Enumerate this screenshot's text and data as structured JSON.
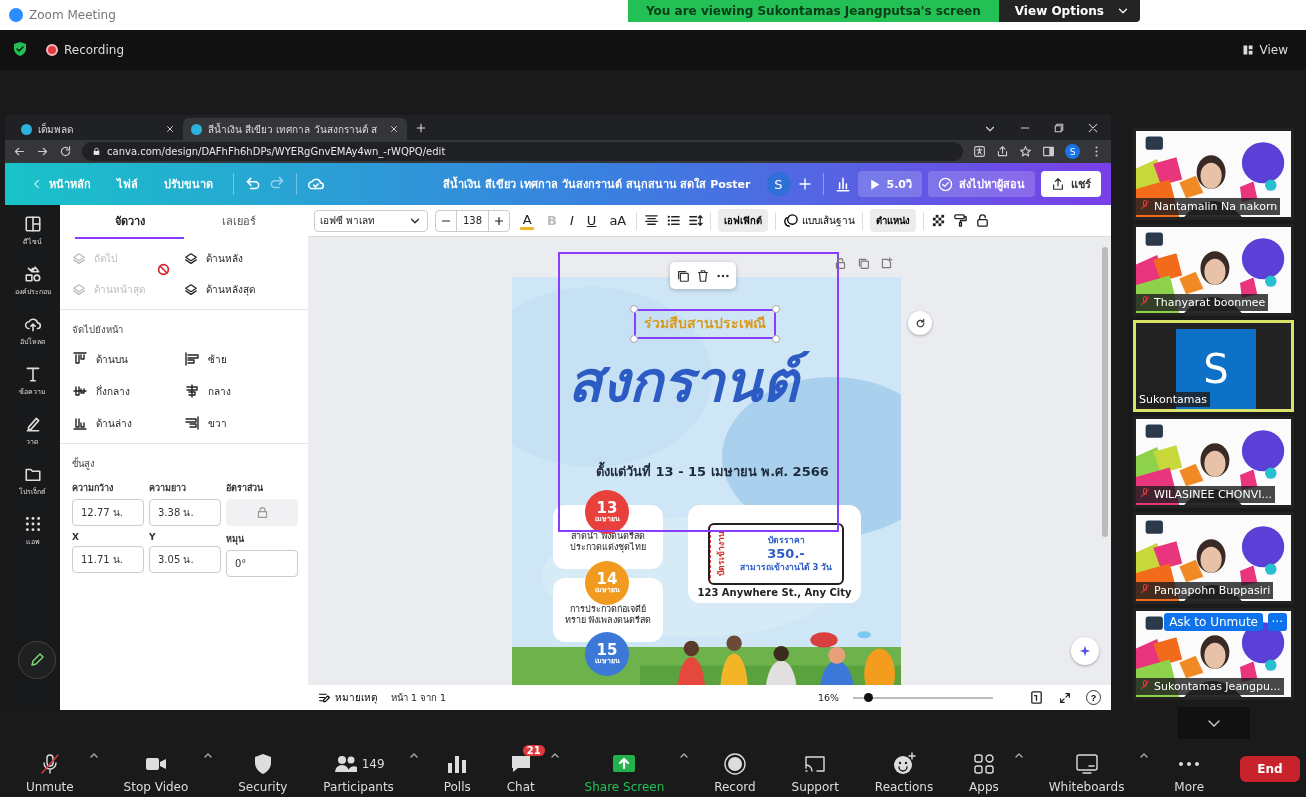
{
  "window": {
    "title": "Zoom Meeting"
  },
  "share_banner": {
    "text": "You are viewing Sukontamas Jeangputsa's screen",
    "button": "View Options"
  },
  "top_bar": {
    "recording": "Recording",
    "view": "View"
  },
  "browser": {
    "tabs": [
      {
        "label": "เต็มพลด",
        "selected": false
      },
      {
        "label": "สีน้ำเงิน สีเขียว เทศกาล วันสงกรานต์ ส",
        "selected": true
      }
    ],
    "url": "canva.com/design/DAFhFh6hDPs/WYERgGnvEMAy4wn_-rWQPQ/edit",
    "profile": "S"
  },
  "canva_header": {
    "nav": [
      "หน้าหลัก",
      "ไฟล์",
      "ปรับขนาด"
    ],
    "title": "สีน้ำเงิน สีเขียว เทศกาล วันสงกรานต์ สนุกสนาน สดใส Poster",
    "avatar": "S",
    "timer": "5.0วิ",
    "send": "ส่งไปหาผู้สอน",
    "share": "แชร์"
  },
  "rail": [
    {
      "kind": "design",
      "label": "ดีไซน์"
    },
    {
      "kind": "elements",
      "label": "องค์ประกอบ"
    },
    {
      "kind": "upload",
      "label": "อัปโหลด"
    },
    {
      "kind": "text",
      "label": "ข้อความ"
    },
    {
      "kind": "draw",
      "label": "วาด"
    },
    {
      "kind": "projects",
      "label": "โปรเจ็กต์"
    },
    {
      "kind": "apps",
      "label": "แอพ"
    }
  ],
  "panel": {
    "tabs": [
      {
        "label": "จัดวาง",
        "selected": true
      },
      {
        "label": "เลเยอร์",
        "selected": false
      }
    ],
    "order": [
      {
        "label": "ถัดไป",
        "disabled": true
      },
      {
        "label": "ด้านหลัง",
        "disabled": false
      },
      {
        "label": "ด้านหน้าสุด",
        "disabled": true
      },
      {
        "label": "ด้านหลังสุด",
        "disabled": false
      }
    ],
    "align_heading": "จัดไปยังหน้า",
    "align": [
      {
        "kind": "top",
        "label": "ด้านบน"
      },
      {
        "kind": "left",
        "label": "ซ้าย"
      },
      {
        "kind": "middle",
        "label": "กึ่งกลาง"
      },
      {
        "kind": "center",
        "label": "กลาง"
      },
      {
        "kind": "bottom",
        "label": "ด้านล่าง"
      },
      {
        "kind": "right",
        "label": "ขวา"
      }
    ],
    "advanced_heading": "ขั้นสูง",
    "fields": [
      {
        "label": "ความกว้าง",
        "value": "12.77 น."
      },
      {
        "label": "ความยาว",
        "value": "3.38 น."
      },
      {
        "label": "อัตราส่วน",
        "kind": "lock"
      },
      {
        "label": "X",
        "value": "11.71 น."
      },
      {
        "label": "Y",
        "value": "3.05 น."
      },
      {
        "label": "หมุน",
        "value": "0°"
      }
    ]
  },
  "toolbar": {
    "font": "เอฟซี พาเลท",
    "size": "138",
    "text_color": "A",
    "formats": [
      {
        "label": "B",
        "disabled": true
      },
      {
        "label": "I",
        "disabled": false
      },
      {
        "label": "U",
        "disabled": false
      },
      {
        "label": "aA",
        "disabled": false
      }
    ],
    "effects": "เอฟเฟิกต์",
    "animate": "แบบเส้นฐาน",
    "position": "ตำแหน่ง"
  },
  "poster": {
    "tagline": "ร่วมสืบสานประเพณี",
    "title": "สงกรานต์",
    "dates": "ตั้งแต่วันที่ 13 - 15 เมษายน พ.ศ. 2566",
    "events": [
      {
        "day": "13",
        "month": "เมษายน",
        "color": "#e8403a",
        "text": "สาดน้ำ ฟังดนตรีสด ประกวดแต่งชุดไทย"
      },
      {
        "day": "14",
        "month": "เมษายน",
        "color": "#f29a1f",
        "text": "การประกวดก่อเจดีย์ทราย ฟังเพลงดนตรีสด"
      },
      {
        "day": "15",
        "month": "เมษายน",
        "color": "#3b78d8"
      }
    ],
    "ticket": {
      "stub": "บัตรเข้างาน",
      "title": "บัตรราคา",
      "price": "350.-",
      "note": "สามารถเข้างานได้ 3 วัน"
    },
    "address": "123 Anywhere St., Any City"
  },
  "editor_footer": {
    "notes": "หมายเหตุ",
    "page": "หน้า 1 จาก 1",
    "zoom": "16%",
    "zoom_slider": {
      "level": 0.11
    },
    "help": "?"
  },
  "participants": [
    {
      "name": "Nantamalin Na nakorn",
      "kind": "video",
      "speaking": false
    },
    {
      "name": "Thanyarat boonmee",
      "kind": "video",
      "speaking": false
    },
    {
      "name": "Sukontamas",
      "kind": "avatar",
      "initial": "S",
      "speaking": true
    },
    {
      "name": "WILASINEE CHONVI...",
      "kind": "video",
      "speaking": false
    },
    {
      "name": "Panpapohn Buppasiri",
      "kind": "video",
      "speaking": false
    },
    {
      "name": "Sukontamas Jeangpu...",
      "kind": "video",
      "speaking": false,
      "ask_button": "Ask to Unmute",
      "more": "···"
    }
  ],
  "controls": [
    {
      "kind": "mic",
      "label": "Unmute",
      "caret": true
    },
    {
      "kind": "video",
      "label": "Stop Video",
      "caret": true
    },
    {
      "kind": "security",
      "label": "Security",
      "caret": false
    },
    {
      "kind": "participants",
      "label": "Participants",
      "count": "149",
      "caret": true
    },
    {
      "kind": "polls",
      "label": "Polls",
      "caret": false
    },
    {
      "kind": "chat",
      "label": "Chat",
      "badge": "21",
      "caret": true
    },
    {
      "kind": "share",
      "label": "Share Screen",
      "caret": true
    },
    {
      "kind": "record",
      "label": "Record",
      "caret": false
    },
    {
      "kind": "support",
      "label": "Support",
      "caret": false
    },
    {
      "kind": "reactions",
      "label": "Reactions",
      "caret": false
    },
    {
      "kind": "apps",
      "label": "Apps",
      "caret": true
    },
    {
      "kind": "whiteboards",
      "label": "Whiteboards",
      "caret": true
    },
    {
      "kind": "more",
      "label": "More",
      "caret": false
    }
  ],
  "end_button": "End"
}
